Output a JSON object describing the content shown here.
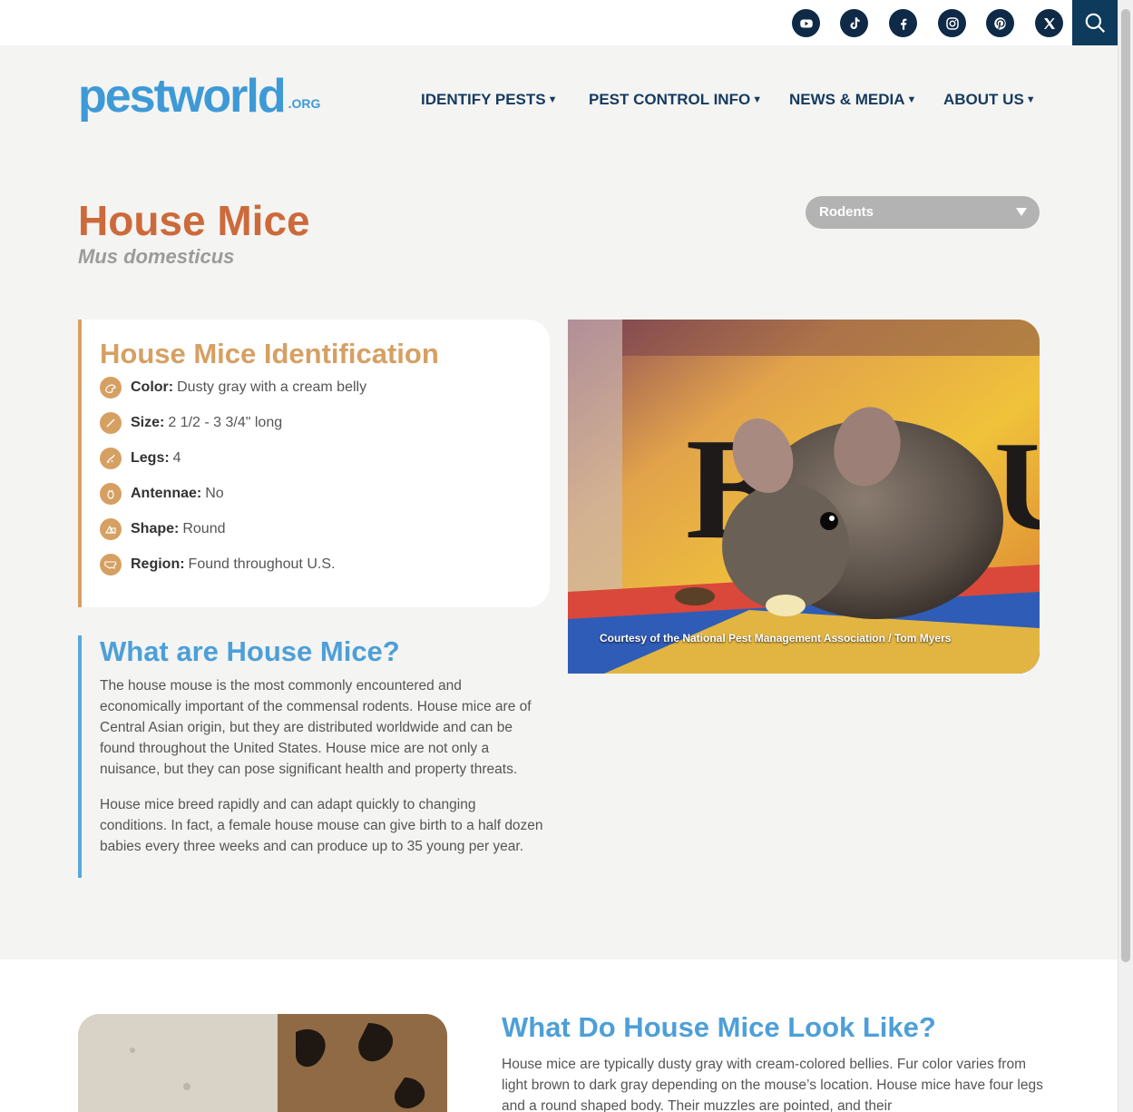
{
  "social": {
    "icons": [
      "youtube-icon",
      "tiktok-icon",
      "facebook-icon",
      "instagram-icon",
      "pinterest-icon",
      "x-icon"
    ],
    "search_icon": "search-icon"
  },
  "header": {
    "logo_main": "pestworld",
    "logo_suffix": ".ORG",
    "nav": [
      {
        "label": "IDENTIFY PESTS"
      },
      {
        "label": "PEST CONTROL INFO"
      },
      {
        "label": "NEWS & MEDIA"
      },
      {
        "label": "ABOUT US"
      }
    ]
  },
  "hero": {
    "title": "House Mice",
    "scientific_name": "Mus domesticus",
    "category_selected": "Rodents"
  },
  "identification": {
    "title": "House Mice Identification",
    "rows": [
      {
        "label": "Color:",
        "value": "Dusty gray with a cream belly",
        "icon": "color-palette-icon"
      },
      {
        "label": "Size:",
        "value": "2 1/2 - 3 3/4\" long",
        "icon": "ruler-icon"
      },
      {
        "label": "Legs:",
        "value": "4",
        "icon": "legs-icon"
      },
      {
        "label": "Antennae:",
        "value": "No",
        "icon": "bug-icon"
      },
      {
        "label": "Shape:",
        "value": "Round",
        "icon": "shapes-icon"
      },
      {
        "label": "Region:",
        "value": "Found throughout U.S.",
        "icon": "us-map-icon"
      }
    ]
  },
  "hero_image": {
    "caption": "Courtesy of the National Pest Management Association / Tom Myers"
  },
  "what_are": {
    "title": "What are House Mice?",
    "paragraphs": [
      "The house mouse is the most commonly encountered and economically important of the commensal rodents. House mice are of Central Asian origin, but they are distributed worldwide and can be found throughout the United States. House mice are not only a nuisance, but they can pose significant health and property threats.",
      "House mice breed rapidly and can adapt quickly to changing conditions. In fact, a female house mouse can give birth to a half dozen babies every three weeks and can produce up to 35 young per year."
    ]
  },
  "look_like": {
    "title": "What Do House Mice Look Like?",
    "paragraph": "House mice are typically dusty gray with cream-colored bellies. Fur color varies from light brown to dark gray depending on the mouse’s location. House mice have four legs and a round shaped body. Their muzzles are pointed, and their"
  },
  "colors": {
    "accent_orange": "#cc6a3b",
    "accent_tan": "#d6a063",
    "accent_blue": "#4d9fd8",
    "navy": "#0e2a47"
  }
}
